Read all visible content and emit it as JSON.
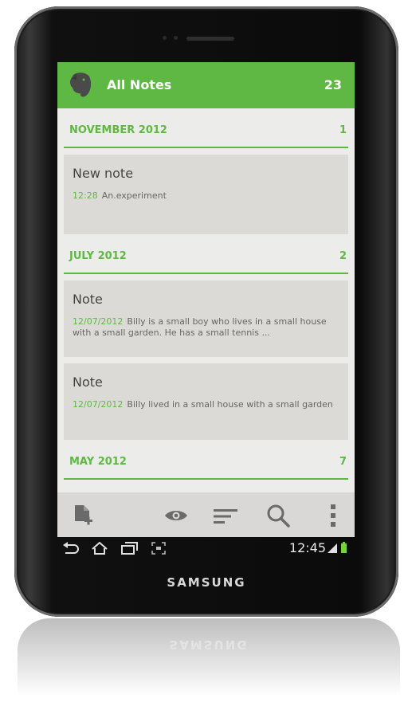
{
  "device": {
    "brand": "SAMSUNG"
  },
  "header": {
    "title": "All Notes",
    "count": "23"
  },
  "sections": [
    {
      "title": "NOVEMBER 2012",
      "count": "1",
      "notes": [
        {
          "title": "New note",
          "date": "12:28",
          "snippet": "An.experiment"
        }
      ]
    },
    {
      "title": "JULY 2012",
      "count": "2",
      "notes": [
        {
          "title": "Note",
          "date": "12/07/2012",
          "snippet": "Billy is a small boy who lives in a small house with a small garden. He has a small tennis ..."
        },
        {
          "title": "Note",
          "date": "12/07/2012",
          "snippet": "Billy lived in a small house with a small garden"
        }
      ]
    },
    {
      "title": "MAY 2012",
      "count": "7",
      "notes": []
    }
  ],
  "toolbar": {
    "icons": [
      "new-note-icon",
      "eye-icon",
      "sort-icon",
      "search-icon",
      "overflow-menu-icon"
    ]
  },
  "statusbar": {
    "time": "12:45"
  },
  "colors": {
    "accent": "#5fb844",
    "note_bg": "#dcdad6",
    "screen_bg": "#ececea"
  }
}
